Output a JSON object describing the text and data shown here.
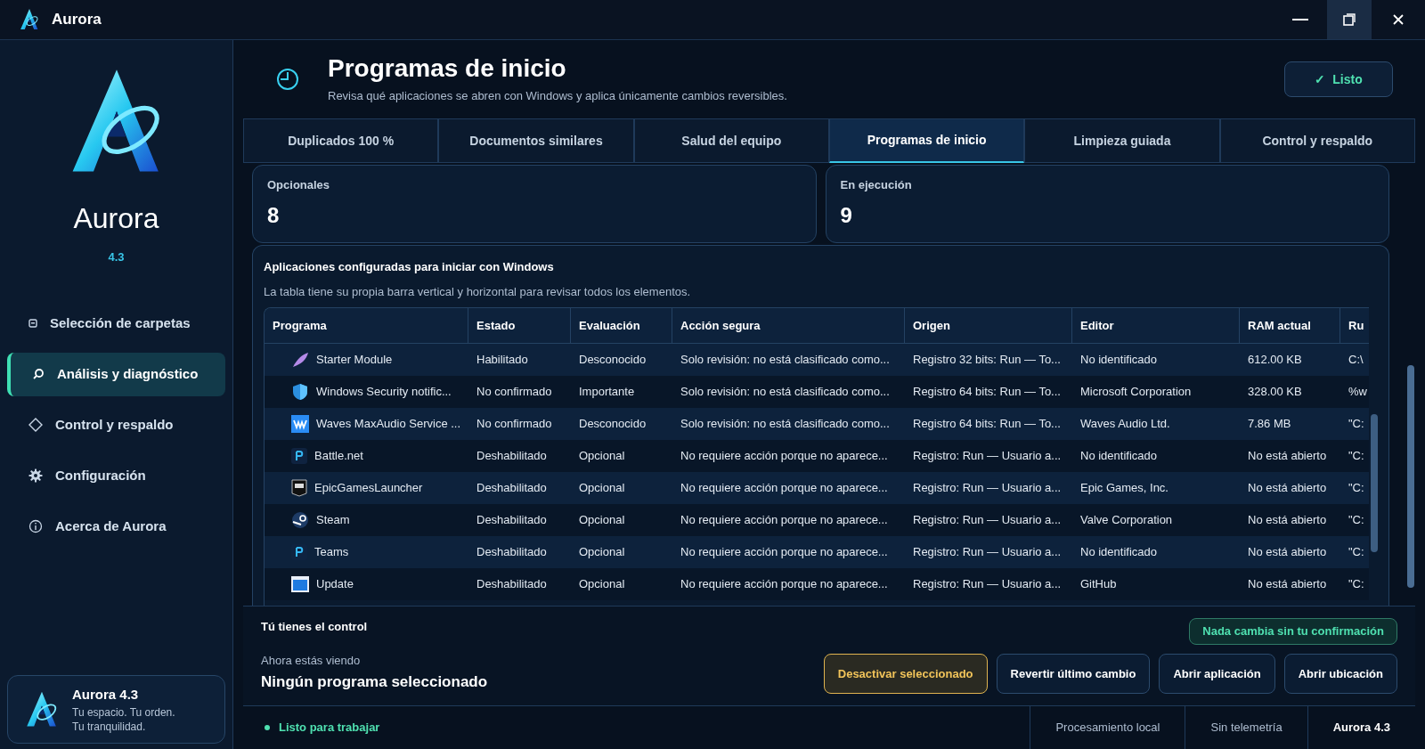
{
  "window": {
    "title": "Aurora"
  },
  "sidebar": {
    "app_name": "Aurora",
    "version": "4.3",
    "items": [
      {
        "label": "Selección de carpetas",
        "kind": "folder",
        "selected": false
      },
      {
        "label": "Análisis y diagnóstico",
        "kind": "search",
        "selected": true
      },
      {
        "label": "Control y respaldo",
        "kind": "diamond",
        "selected": false
      },
      {
        "label": "Configuración",
        "kind": "gear",
        "selected": false
      },
      {
        "label": "Acerca de Aurora",
        "kind": "info",
        "selected": false
      }
    ],
    "footer": {
      "title": "Aurora 4.3",
      "lines": [
        "Tu espacio. Tu orden.",
        "Tu tranquilidad."
      ]
    }
  },
  "header": {
    "title": "Programas de inicio",
    "subtitle": "Revisa qué aplicaciones se abren con Windows y aplica únicamente cambios reversibles.",
    "status_button": {
      "check": "✓",
      "label": "Listo"
    }
  },
  "tabs": [
    {
      "label": "Duplicados 100 %",
      "selected": false
    },
    {
      "label": "Documentos similares",
      "selected": false
    },
    {
      "label": "Salud del equipo",
      "selected": false
    },
    {
      "label": "Programas de inicio",
      "selected": true
    },
    {
      "label": "Limpieza guiada",
      "selected": false
    },
    {
      "label": "Control y respaldo",
      "selected": false
    }
  ],
  "stats": [
    {
      "label": "Opcionales",
      "value": "8"
    },
    {
      "label": "En ejecución",
      "value": "9"
    }
  ],
  "table_panel": {
    "title": "Aplicaciones configuradas para iniciar con Windows",
    "description": "La tabla tiene su propia barra vertical y horizontal para revisar todos los elementos.",
    "columns": [
      "Programa",
      "Estado",
      "Evaluación",
      "Acción segura",
      "Origen",
      "Editor",
      "RAM actual",
      "Ru"
    ],
    "rows": [
      {
        "kind": "feather",
        "cells": [
          "Starter Module",
          "Habilitado",
          "Desconocido",
          "Solo revisión: no está clasificado como...",
          "Registro 32 bits: Run — To...",
          "No identificado",
          "612.00 KB",
          "C:\\"
        ]
      },
      {
        "kind": "shield",
        "cells": [
          "Windows Security notific...",
          "No confirmado",
          "Importante",
          "Solo revisión: no está clasificado como...",
          "Registro 64 bits: Run — To...",
          "Microsoft Corporation",
          "328.00 KB",
          "%w"
        ]
      },
      {
        "kind": "wave",
        "cells": [
          "Waves MaxAudio Service ...",
          "No confirmado",
          "Desconocido",
          "Solo revisión: no está clasificado como...",
          "Registro 64 bits: Run — To...",
          "Waves Audio Ltd.",
          "7.86 MB",
          "\"C:"
        ]
      },
      {
        "kind": "tile",
        "cells": [
          "Battle.net",
          "Deshabilitado",
          "Opcional",
          "No requiere acción porque no aparece...",
          "Registro: Run — Usuario a...",
          "No identificado",
          "No está abierto",
          "\"C:"
        ]
      },
      {
        "kind": "epic",
        "cells": [
          "EpicGamesLauncher",
          "Deshabilitado",
          "Opcional",
          "No requiere acción porque no aparece...",
          "Registro: Run — Usuario a...",
          "Epic Games, Inc.",
          "No está abierto",
          "\"C:"
        ]
      },
      {
        "kind": "steam",
        "cells": [
          "Steam",
          "Deshabilitado",
          "Opcional",
          "No requiere acción porque no aparece...",
          "Registro: Run — Usuario a...",
          "Valve Corporation",
          "No está abierto",
          "\"C:"
        ]
      },
      {
        "kind": "tile",
        "cells": [
          "Teams",
          "Deshabilitado",
          "Opcional",
          "No requiere acción porque no aparece...",
          "Registro: Run — Usuario a...",
          "No identificado",
          "No está abierto",
          "\"C:"
        ]
      },
      {
        "kind": "window",
        "cells": [
          "Update",
          "Deshabilitado",
          "Opcional",
          "No requiere acción porque no aparece...",
          "Registro: Run — Usuario a...",
          "GitHub",
          "No está abierto",
          "\"C:"
        ]
      }
    ]
  },
  "action_bar": {
    "title": "Tú tienes el control",
    "badge": "Nada cambia sin tu confirmación",
    "viewing_label": "Ahora estás viendo",
    "viewing_value": "Ningún programa seleccionado",
    "buttons": [
      {
        "label": "Desactivar seleccionado",
        "kind": "primary"
      },
      {
        "label": "Revertir último cambio",
        "kind": "secondary"
      },
      {
        "label": "Abrir aplicación",
        "kind": "secondary"
      },
      {
        "label": "Abrir ubicación",
        "kind": "secondary"
      }
    ]
  },
  "status_bar": {
    "status": "Listo para trabajar",
    "items": [
      {
        "label": "Procesamiento local",
        "bold": false
      },
      {
        "label": "Sin telemetría",
        "bold": false
      },
      {
        "label": "Aurora 4.3",
        "bold": true
      }
    ]
  }
}
